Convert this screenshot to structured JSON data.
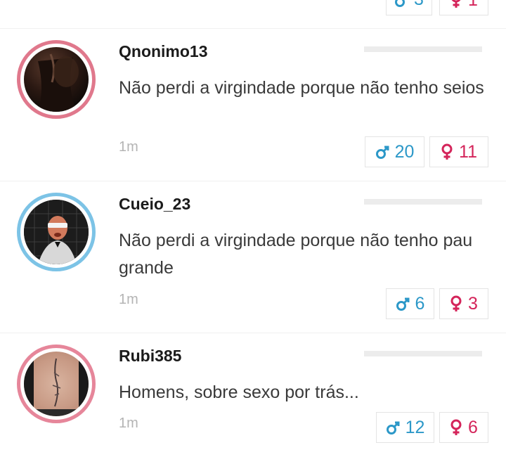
{
  "top_partial": {
    "male_count": "3",
    "female_count": "1"
  },
  "posts": [
    {
      "username": "Qnonimo13",
      "text": "Não perdi a virgindade porque não tenho seios",
      "time": "1m",
      "male_votes": "20",
      "female_votes": "11"
    },
    {
      "username": "Cueio_23",
      "text": "Não perdi a virgindade porque não tenho pau grande",
      "time": "1m",
      "male_votes": "6",
      "female_votes": "3"
    },
    {
      "username": "Rubi385",
      "text": "Homens, sobre sexo por trás...",
      "time": "1m",
      "male_votes": "12",
      "female_votes": "6"
    }
  ],
  "colors": {
    "male": "#2c98c8",
    "female": "#d4245a",
    "ring_pink": "#e0788c",
    "ring_blue": "#7cc3e6"
  },
  "icons": {
    "male": "male-symbol-icon",
    "female": "female-symbol-icon"
  }
}
